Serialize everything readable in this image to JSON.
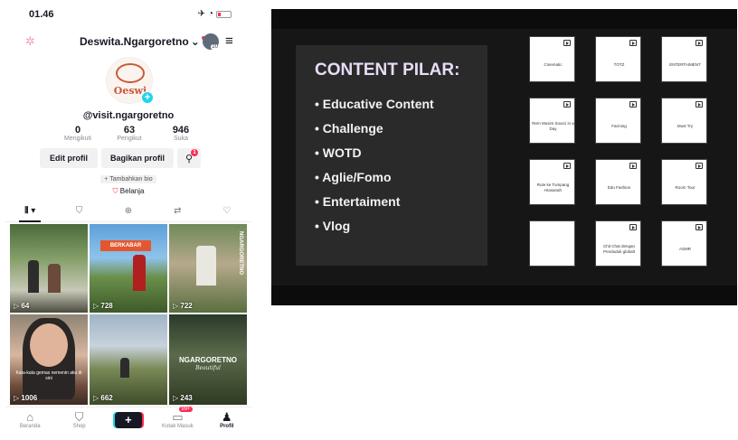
{
  "phone": {
    "status_time": "01.46",
    "username": "Deswita.Ngargoretno",
    "notif_count": "20",
    "avatar_text": "Oeswi",
    "handle": "@visit.ngargoretno",
    "stats": [
      {
        "value": "0",
        "label": "Mengikuti"
      },
      {
        "value": "63",
        "label": "Pengikut"
      },
      {
        "value": "946",
        "label": "Suka"
      }
    ],
    "buttons": {
      "edit": "Edit profil",
      "share": "Bagikan profil",
      "add_friend_badge": "1"
    },
    "bio_hint": "+ Tambahkan bio",
    "shop_link": "Belanja",
    "videos": [
      {
        "views": "64",
        "overlay": ""
      },
      {
        "views": "728",
        "overlay": "BERKABAR"
      },
      {
        "views": "722",
        "overlay": "NGARGORETNO"
      },
      {
        "views": "1006",
        "overlay": "Kata-kata gemas nemenin aku di sini"
      },
      {
        "views": "662",
        "overlay": ""
      },
      {
        "views": "243",
        "overlay": "NGARGORETNO",
        "overlay_sub": "Beautiful"
      }
    ],
    "bottom_nav": [
      {
        "label": "Beranda"
      },
      {
        "label": "Shop"
      },
      {
        "label": ""
      },
      {
        "label": "Kotak Masuk",
        "badge": "99+"
      },
      {
        "label": "Profil"
      }
    ]
  },
  "slide": {
    "title": "CONTENT PILAR:",
    "pillars": [
      "Educative Content",
      "Challenge",
      "WOTD",
      "Aglie/Fomo",
      "Entertaiment",
      "Vlog"
    ],
    "cards": [
      "Cinematic",
      "TOTZ",
      "ENTERTAIMENT",
      "Rem Musim Sourci in a Day",
      "Farming",
      "Must Try",
      "Rute ke Tumpang Hiasanah",
      "Edu Fashion",
      "Room Tour",
      "",
      "Chit Chat dengan Penduduk globalt",
      "ASMR"
    ]
  }
}
